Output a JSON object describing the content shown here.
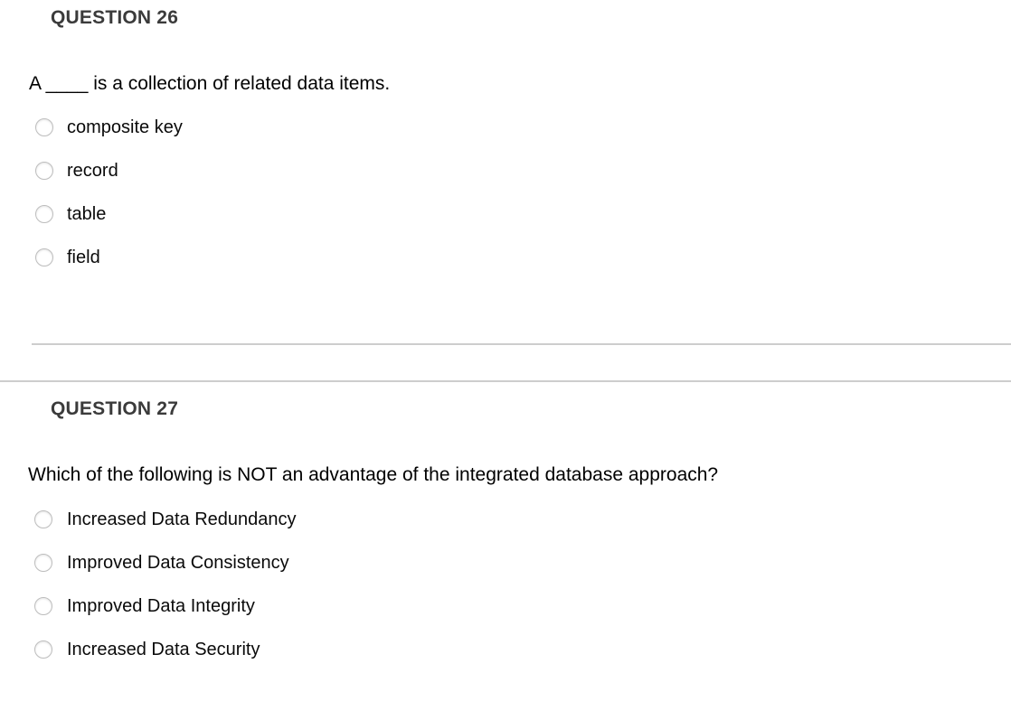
{
  "colors": {
    "page_background": "#ffffff",
    "heading_text": "#3b3b3b",
    "body_text": "#010101",
    "divider": "#cdcdcd",
    "radio_border": "#bdbdbd",
    "radio_fill": "#ffffff"
  },
  "questions": [
    {
      "heading": "QUESTION 26",
      "prompt": "A ____ is a collection of related data items.",
      "options": [
        {
          "label": "composite key",
          "selected": false
        },
        {
          "label": "record",
          "selected": false
        },
        {
          "label": "table",
          "selected": false
        },
        {
          "label": "field",
          "selected": false
        }
      ]
    },
    {
      "heading": "QUESTION 27",
      "prompt": "Which of the following is NOT an advantage of the integrated database approach?",
      "options": [
        {
          "label": "Increased Data Redundancy",
          "selected": false
        },
        {
          "label": "Improved Data Consistency",
          "selected": false
        },
        {
          "label": "Improved Data Integrity",
          "selected": false
        },
        {
          "label": "Increased Data Security",
          "selected": false
        }
      ]
    }
  ]
}
